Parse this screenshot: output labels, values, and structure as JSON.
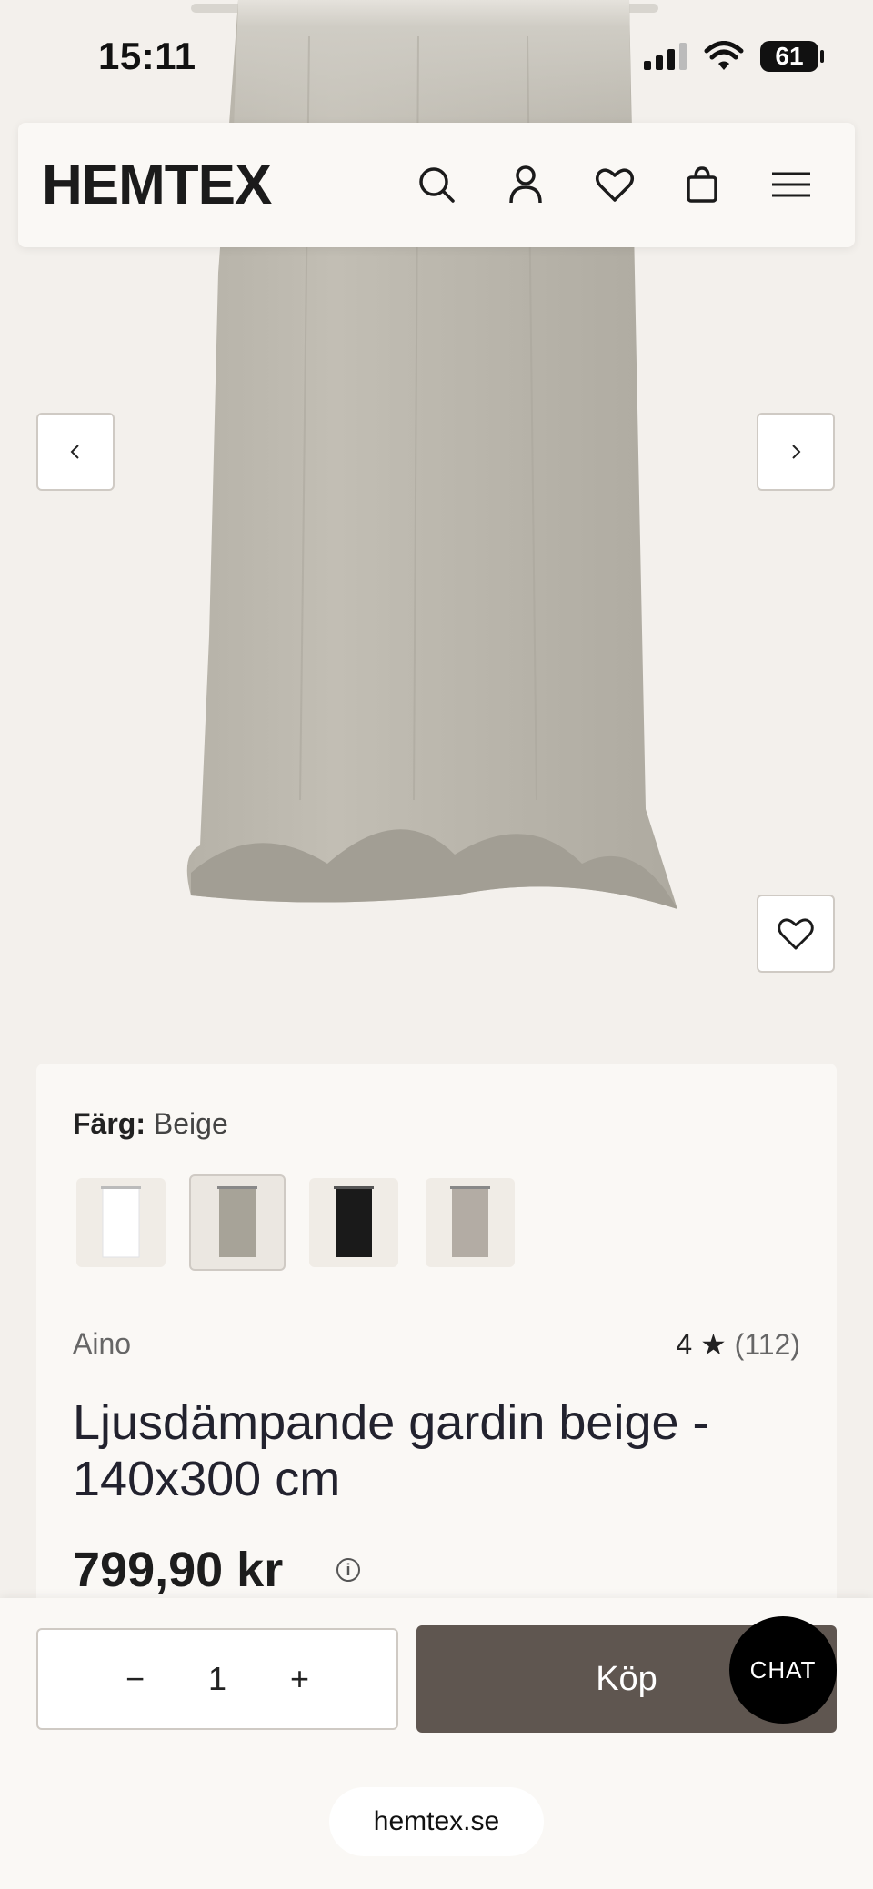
{
  "status_bar": {
    "time": "15:11",
    "battery": "61"
  },
  "header": {
    "logo": "HEMTEX"
  },
  "product": {
    "color_label": "Färg:",
    "color_value": "Beige",
    "brand": "Aino",
    "rating": "4",
    "rating_star": "★",
    "review_count": "(112)",
    "title": "Ljusdämpande gardin beige - 140x300 cm",
    "price": "799,90 kr"
  },
  "swatches": [
    {
      "name": "white",
      "color": "#ffffff"
    },
    {
      "name": "beige",
      "color": "#a7a398"
    },
    {
      "name": "black",
      "color": "#1a1a1a"
    },
    {
      "name": "greige",
      "color": "#b3aca4"
    }
  ],
  "purchase": {
    "quantity": "1",
    "buy_label": "Köp",
    "minus": "−",
    "plus": "+"
  },
  "chat_label": "CHAT",
  "browser": {
    "url": "hemtex.se"
  },
  "icons": [
    "search-icon",
    "account-icon",
    "heart-icon",
    "bag-icon",
    "menu-icon",
    "chevron-left-icon",
    "chevron-right-icon",
    "favorite-icon",
    "info-icon"
  ]
}
